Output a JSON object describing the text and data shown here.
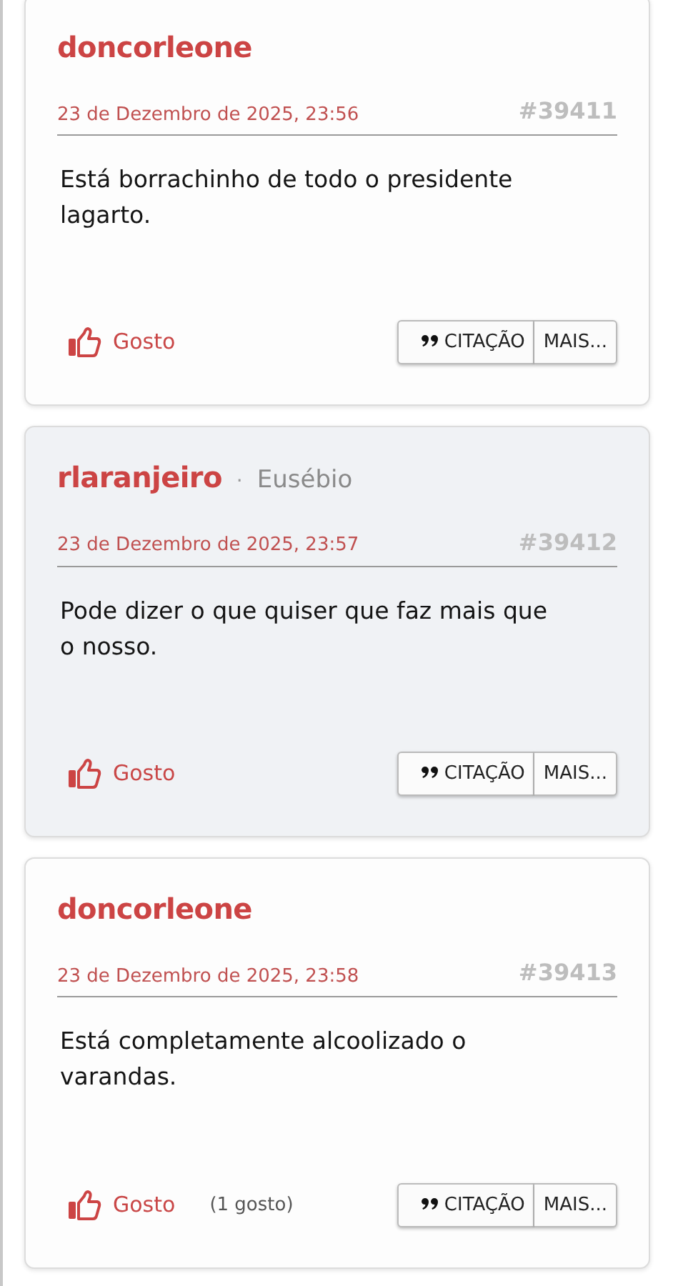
{
  "posts": [
    {
      "author": "doncorleone",
      "date": "23 de Dezembro de 2025, 23:56",
      "number": "#39411",
      "body": "Está borrachinho de todo o presidente lagarto.",
      "highlighted": false,
      "like": "Gosto",
      "quote_button": "CITAÇÃO",
      "more_button": "MAIS..."
    },
    {
      "author": "rlaranjeiro",
      "separator": "·",
      "title": "Eusébio",
      "date": "23 de Dezembro de 2025, 23:57",
      "number": "#39412",
      "body": "Pode dizer o que quiser que faz mais que o nosso.",
      "highlighted": true,
      "like": "Gosto",
      "quote_button": "CITAÇÃO",
      "more_button": "MAIS..."
    },
    {
      "author": "doncorleone",
      "date": "23 de Dezembro de 2025, 23:58",
      "number": "#39413",
      "body": "Está completamente alcoolizado o varandas.",
      "highlighted": false,
      "like": "Gosto",
      "like_count": "(1 gosto)",
      "quote_button": "CITAÇÃO",
      "more_button": "MAIS..."
    }
  ]
}
